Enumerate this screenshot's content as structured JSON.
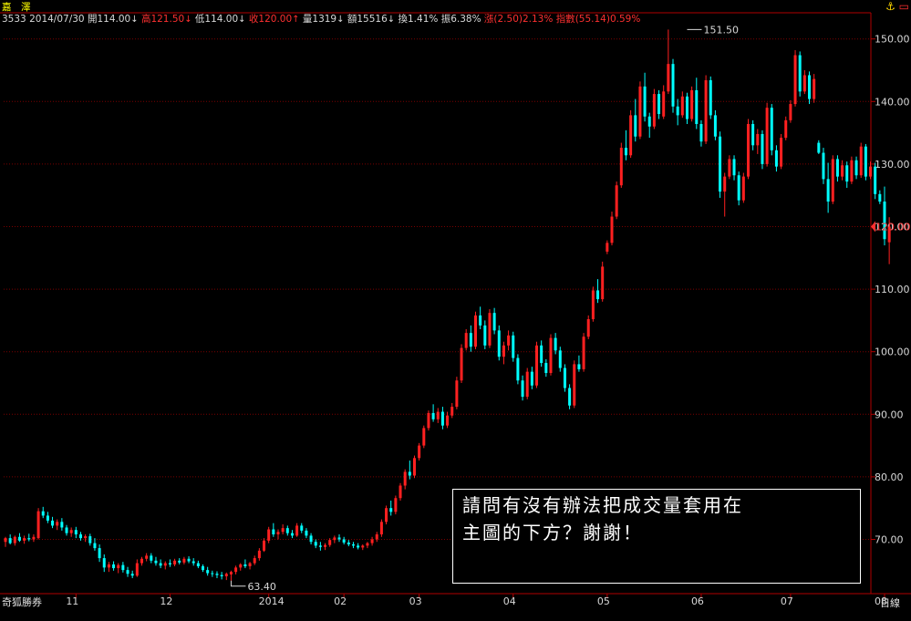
{
  "header": {
    "name": "嘉　澤",
    "code": "3533",
    "date": "2014/07/30",
    "open_label": "開",
    "open_value": "114.00",
    "high_label": "高",
    "high_value": "121.50",
    "low_label": "低",
    "low_value": "114.00",
    "close_label": "收",
    "close_value": "120.00",
    "volume_label": "量",
    "volume_value": "1319",
    "amount_label": "額",
    "amount_value": "15516",
    "turnover_label": "換",
    "turnover_value": "1.41%",
    "amplitude_label": "振",
    "amplitude_value": "6.38%",
    "change_label": "漲",
    "change_value": "(2.50)2.13%",
    "index_label": "指數",
    "index_value": "(55.14)0.59%",
    "arrow_down": "↓",
    "arrow_up": "↑"
  },
  "icons": [
    "anchor-icon",
    "window-icon"
  ],
  "source_label": "奇狐勝券",
  "x_unit_label": "日線",
  "question_text": [
    "請問有沒有辦法把成交量套用在",
    "主圖的下方？謝謝！"
  ],
  "colors": {
    "up": "#ff2020",
    "down": "#00ffff",
    "grid": "#7a0000",
    "axis": "#b00000",
    "text": "#d8d8d8",
    "current": "#ff3030"
  },
  "chart_data": {
    "type": "candlestick",
    "y_ticks": [
      70,
      80,
      90,
      100,
      110,
      120,
      130,
      140,
      150
    ],
    "y_tick_labels": [
      "70.00",
      "80.00",
      "90.00",
      "100.00",
      "110.00",
      "120.00",
      "130.00",
      "140.00",
      "150.00"
    ],
    "ylim": [
      64,
      152
    ],
    "current_price_label": "120.00",
    "current_price": 120,
    "annotations": [
      {
        "text": "151.50",
        "value": 151.5,
        "day": 145
      },
      {
        "text": "63.40",
        "value": 63.4,
        "day": 48
      }
    ],
    "x_labels": [
      {
        "text": "11",
        "day": 15
      },
      {
        "text": "12",
        "day": 35
      },
      {
        "text": "2014",
        "day": 56
      },
      {
        "text": "02",
        "day": 72
      },
      {
        "text": "03",
        "day": 88
      },
      {
        "text": "04",
        "day": 108
      },
      {
        "text": "05",
        "day": 128
      },
      {
        "text": "06",
        "day": 148
      },
      {
        "text": "07",
        "day": 167
      },
      {
        "text": "08",
        "day": 187
      }
    ],
    "grid": true,
    "candles": [
      [
        69.6,
        70.4,
        68.8,
        70.2
      ],
      [
        70.2,
        70.8,
        69.2,
        69.4
      ],
      [
        69.4,
        70.6,
        69.0,
        70.4
      ],
      [
        70.4,
        71.0,
        69.6,
        69.8
      ],
      [
        69.8,
        70.6,
        69.3,
        70.2
      ],
      [
        70.2,
        70.9,
        69.7,
        70.0
      ],
      [
        70.0,
        70.8,
        69.6,
        70.4
      ],
      [
        70.2,
        75.0,
        70.0,
        74.5
      ],
      [
        74.5,
        75.2,
        73.4,
        73.8
      ],
      [
        73.8,
        74.4,
        72.6,
        73.0
      ],
      [
        73.0,
        73.6,
        71.8,
        72.2
      ],
      [
        72.2,
        73.2,
        71.5,
        72.8
      ],
      [
        72.8,
        73.4,
        71.4,
        71.9
      ],
      [
        71.9,
        72.3,
        70.6,
        71.0
      ],
      [
        71.0,
        71.9,
        70.4,
        71.5
      ],
      [
        71.5,
        72.0,
        70.2,
        70.8
      ],
      [
        70.8,
        71.2,
        69.8,
        70.2
      ],
      [
        70.2,
        70.8,
        69.6,
        70.5
      ],
      [
        70.5,
        70.9,
        69.0,
        69.4
      ],
      [
        69.4,
        70.2,
        68.2,
        68.6
      ],
      [
        68.6,
        69.2,
        66.4,
        67.0
      ],
      [
        67.0,
        67.6,
        64.8,
        65.5
      ],
      [
        65.5,
        66.4,
        64.8,
        66.0
      ],
      [
        66.0,
        66.5,
        65.0,
        65.4
      ],
      [
        65.4,
        66.2,
        64.6,
        65.9
      ],
      [
        65.9,
        66.4,
        64.7,
        65.1
      ],
      [
        65.1,
        65.6,
        64.0,
        64.5
      ],
      [
        64.5,
        65.0,
        63.8,
        64.2
      ],
      [
        64.2,
        66.8,
        64.0,
        66.2
      ],
      [
        66.2,
        67.2,
        65.8,
        66.9
      ],
      [
        66.9,
        67.8,
        66.5,
        67.4
      ],
      [
        67.4,
        67.8,
        66.2,
        66.6
      ],
      [
        66.6,
        67.2,
        65.8,
        66.2
      ],
      [
        66.2,
        66.8,
        65.4,
        65.8
      ],
      [
        65.8,
        66.5,
        65.2,
        66.2
      ],
      [
        66.2,
        66.8,
        65.6,
        66.0
      ],
      [
        66.0,
        66.9,
        65.7,
        66.6
      ],
      [
        66.6,
        67.0,
        66.0,
        66.3
      ],
      [
        66.3,
        67.2,
        66.0,
        66.9
      ],
      [
        66.9,
        67.3,
        66.2,
        66.5
      ],
      [
        66.5,
        67.0,
        65.8,
        66.2
      ],
      [
        66.2,
        66.6,
        65.4,
        65.7
      ],
      [
        65.7,
        66.0,
        64.8,
        65.1
      ],
      [
        65.1,
        65.6,
        64.2,
        64.6
      ],
      [
        64.6,
        65.0,
        64.0,
        64.5
      ],
      [
        64.5,
        64.9,
        63.8,
        64.3
      ],
      [
        64.3,
        64.8,
        63.6,
        64.1
      ],
      [
        64.1,
        64.7,
        63.5,
        64.5
      ],
      [
        64.4,
        65.0,
        63.4,
        64.8
      ],
      [
        64.8,
        65.8,
        64.4,
        65.5
      ],
      [
        65.5,
        66.2,
        65.0,
        66.0
      ],
      [
        66.0,
        66.8,
        65.4,
        65.7
      ],
      [
        65.7,
        66.4,
        65.2,
        66.2
      ],
      [
        66.2,
        67.4,
        65.9,
        67.0
      ],
      [
        67.0,
        68.6,
        66.6,
        68.2
      ],
      [
        68.2,
        70.2,
        68.0,
        69.8
      ],
      [
        69.8,
        72.0,
        69.4,
        71.6
      ],
      [
        71.6,
        72.6,
        70.4,
        70.8
      ],
      [
        70.8,
        71.6,
        70.0,
        71.2
      ],
      [
        71.2,
        72.4,
        70.8,
        71.8
      ],
      [
        71.8,
        72.2,
        70.6,
        71.0
      ],
      [
        71.0,
        71.5,
        70.2,
        70.6
      ],
      [
        70.6,
        72.6,
        70.4,
        72.2
      ],
      [
        72.2,
        72.6,
        71.0,
        71.4
      ],
      [
        71.4,
        71.8,
        70.2,
        70.6
      ],
      [
        70.6,
        71.0,
        69.2,
        69.6
      ],
      [
        69.6,
        70.0,
        68.6,
        69.0
      ],
      [
        69.0,
        69.6,
        68.2,
        68.8
      ],
      [
        68.8,
        69.4,
        68.3,
        69.1
      ],
      [
        69.1,
        70.2,
        68.8,
        69.9
      ],
      [
        69.9,
        70.6,
        69.4,
        70.3
      ],
      [
        70.3,
        70.8,
        69.6,
        70.0
      ],
      [
        70.0,
        70.4,
        69.2,
        69.5
      ],
      [
        69.5,
        69.9,
        68.9,
        69.2
      ],
      [
        69.2,
        69.6,
        68.6,
        69.0
      ],
      [
        69.0,
        69.4,
        68.4,
        68.7
      ],
      [
        68.7,
        69.2,
        68.3,
        69.0
      ],
      [
        69.0,
        69.6,
        68.6,
        69.4
      ],
      [
        69.4,
        70.4,
        69.0,
        70.0
      ],
      [
        70.0,
        71.2,
        69.6,
        70.8
      ],
      [
        70.8,
        73.2,
        70.4,
        72.8
      ],
      [
        72.8,
        75.4,
        72.4,
        75.0
      ],
      [
        75.0,
        76.2,
        73.8,
        74.4
      ],
      [
        74.4,
        77.0,
        74.0,
        76.6
      ],
      [
        76.6,
        79.0,
        76.2,
        78.6
      ],
      [
        78.6,
        81.2,
        78.0,
        80.8
      ],
      [
        80.8,
        82.6,
        79.6,
        80.2
      ],
      [
        80.2,
        83.4,
        79.8,
        83.0
      ],
      [
        83.0,
        85.4,
        82.6,
        85.0
      ],
      [
        85.0,
        88.2,
        84.6,
        87.8
      ],
      [
        87.8,
        90.6,
        87.4,
        90.2
      ],
      [
        90.2,
        91.6,
        88.8,
        89.2
      ],
      [
        89.2,
        91.0,
        88.6,
        90.4
      ],
      [
        90.4,
        91.2,
        87.6,
        88.2
      ],
      [
        88.2,
        90.4,
        87.8,
        89.8
      ],
      [
        89.8,
        91.8,
        89.4,
        91.2
      ],
      [
        91.2,
        96.0,
        90.8,
        95.4
      ],
      [
        95.4,
        101.2,
        95.0,
        100.6
      ],
      [
        100.6,
        103.6,
        100.2,
        103.0
      ],
      [
        103.0,
        104.2,
        100.0,
        100.8
      ],
      [
        100.8,
        106.4,
        100.4,
        105.8
      ],
      [
        105.8,
        107.2,
        103.6,
        104.2
      ],
      [
        104.2,
        105.0,
        100.4,
        101.0
      ],
      [
        101.0,
        106.8,
        100.6,
        106.2
      ],
      [
        106.2,
        107.0,
        102.8,
        103.4
      ],
      [
        103.4,
        104.2,
        98.6,
        99.2
      ],
      [
        99.2,
        101.6,
        98.0,
        101.0
      ],
      [
        101.0,
        103.4,
        100.2,
        102.6
      ],
      [
        102.6,
        103.2,
        98.4,
        99.0
      ],
      [
        99.0,
        99.6,
        94.8,
        95.4
      ],
      [
        95.4,
        96.2,
        92.2,
        92.8
      ],
      [
        92.8,
        97.4,
        92.4,
        96.8
      ],
      [
        96.8,
        97.6,
        94.0,
        94.6
      ],
      [
        94.6,
        101.6,
        94.2,
        101.0
      ],
      [
        101.0,
        101.8,
        97.6,
        98.2
      ],
      [
        98.2,
        98.8,
        96.0,
        96.6
      ],
      [
        96.6,
        102.8,
        96.2,
        102.2
      ],
      [
        102.2,
        103.0,
        99.6,
        100.2
      ],
      [
        100.2,
        100.8,
        96.8,
        97.4
      ],
      [
        97.4,
        98.0,
        93.6,
        94.2
      ],
      [
        94.2,
        94.8,
        90.8,
        91.4
      ],
      [
        91.4,
        98.6,
        91.0,
        98.0
      ],
      [
        98.0,
        99.4,
        96.8,
        97.2
      ],
      [
        97.2,
        103.0,
        96.8,
        102.4
      ],
      [
        102.4,
        105.8,
        102.0,
        105.2
      ],
      [
        105.2,
        110.4,
        104.8,
        109.8
      ],
      [
        109.8,
        111.6,
        107.8,
        108.4
      ],
      [
        108.4,
        114.4,
        108.0,
        113.6
      ],
      [
        116.0,
        117.8,
        115.6,
        117.4
      ],
      [
        117.4,
        122.4,
        117.0,
        121.6
      ],
      [
        121.6,
        127.2,
        121.2,
        126.6
      ],
      [
        126.6,
        133.4,
        126.2,
        132.6
      ],
      [
        132.6,
        135.4,
        130.6,
        131.4
      ],
      [
        131.4,
        138.6,
        131.0,
        137.8
      ],
      [
        137.8,
        140.4,
        133.6,
        134.4
      ],
      [
        134.4,
        143.2,
        134.0,
        142.4
      ],
      [
        142.4,
        144.6,
        136.8,
        137.6
      ],
      [
        137.6,
        138.2,
        134.2,
        136.0
      ],
      [
        136.0,
        142.0,
        135.6,
        141.2
      ],
      [
        141.2,
        141.8,
        137.2,
        138.0
      ],
      [
        137.6,
        142.6,
        137.2,
        141.6
      ],
      [
        141.6,
        151.5,
        141.2,
        146.0
      ],
      [
        146.0,
        146.8,
        138.2,
        139.2
      ],
      [
        139.2,
        140.4,
        136.2,
        137.8
      ],
      [
        137.8,
        141.6,
        137.4,
        140.8
      ],
      [
        140.8,
        141.4,
        136.4,
        137.2
      ],
      [
        137.2,
        142.4,
        136.8,
        141.8
      ],
      [
        141.8,
        143.8,
        135.6,
        136.4
      ],
      [
        136.4,
        137.0,
        132.8,
        133.6
      ],
      [
        133.6,
        144.2,
        133.2,
        143.4
      ],
      [
        143.4,
        144.0,
        137.2,
        137.8
      ],
      [
        137.8,
        138.6,
        133.8,
        134.4
      ],
      [
        134.4,
        135.2,
        124.6,
        125.6
      ],
      [
        125.6,
        128.6,
        121.6,
        128.0
      ],
      [
        128.0,
        131.4,
        127.6,
        130.8
      ],
      [
        130.8,
        131.4,
        127.4,
        128.2
      ],
      [
        128.2,
        128.8,
        123.4,
        124.2
      ],
      [
        124.2,
        128.6,
        123.8,
        128.0
      ],
      [
        128.0,
        137.2,
        127.6,
        136.4
      ],
      [
        136.4,
        137.0,
        132.2,
        133.0
      ],
      [
        133.0,
        135.6,
        131.6,
        134.8
      ],
      [
        134.8,
        135.4,
        129.2,
        130.0
      ],
      [
        130.0,
        139.8,
        129.6,
        139.0
      ],
      [
        139.0,
        139.6,
        131.4,
        132.2
      ],
      [
        132.2,
        133.0,
        128.8,
        129.6
      ],
      [
        129.6,
        134.8,
        129.2,
        134.2
      ],
      [
        134.2,
        137.6,
        133.8,
        137.0
      ],
      [
        137.0,
        140.2,
        136.6,
        139.6
      ],
      [
        139.6,
        148.2,
        139.2,
        147.4
      ],
      [
        147.4,
        148.0,
        140.8,
        141.6
      ],
      [
        141.6,
        145.0,
        141.2,
        144.2
      ],
      [
        144.2,
        144.8,
        139.6,
        140.4
      ],
      [
        140.4,
        144.4,
        139.8,
        143.6
      ],
      [
        133.4,
        133.8,
        131.6,
        131.8
      ],
      [
        131.8,
        132.6,
        126.8,
        127.6
      ],
      [
        127.6,
        130.2,
        122.2,
        124.0
      ],
      [
        124.0,
        131.4,
        123.6,
        130.8
      ],
      [
        130.8,
        131.4,
        127.2,
        128.0
      ],
      [
        128.0,
        130.6,
        127.4,
        129.8
      ],
      [
        129.8,
        130.4,
        126.2,
        127.2
      ],
      [
        127.2,
        131.2,
        126.8,
        130.6
      ],
      [
        130.6,
        131.2,
        127.6,
        128.2
      ],
      [
        128.2,
        133.4,
        127.8,
        132.8
      ],
      [
        132.8,
        133.2,
        127.4,
        128.0
      ],
      [
        128.0,
        130.4,
        127.6,
        129.6
      ],
      [
        129.6,
        130.2,
        124.4,
        125.2
      ],
      [
        125.2,
        125.8,
        123.6,
        124.0
      ],
      [
        124.0,
        126.4,
        117.0,
        118.0
      ],
      [
        117.5,
        121.5,
        114.0,
        120.0
      ]
    ]
  }
}
